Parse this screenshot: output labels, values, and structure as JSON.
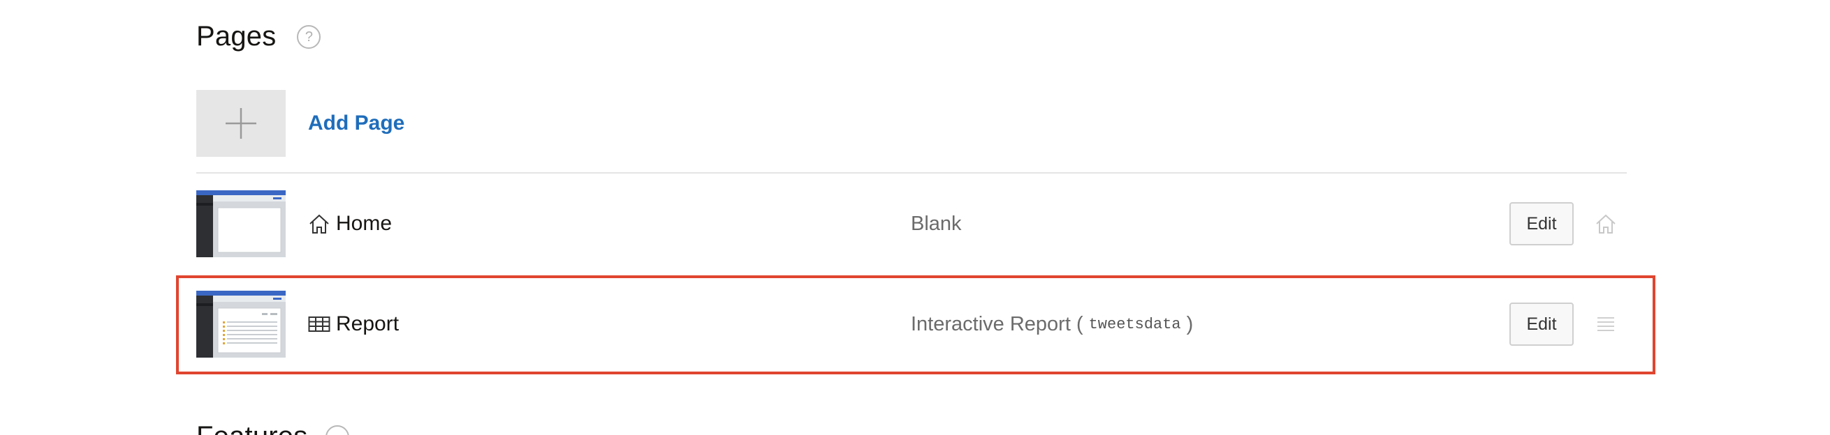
{
  "pages_section": {
    "title": "Pages",
    "help_icon": "?"
  },
  "add_page": {
    "label": "Add Page",
    "icon": "plus-icon"
  },
  "pages": [
    {
      "name": "Home",
      "icon": "home-icon",
      "type": "Blank",
      "edit_label": "Edit",
      "trailing_icon": "home-icon"
    },
    {
      "name": "Report",
      "icon": "table-icon",
      "type": "Interactive Report (",
      "type_source": "tweetsdata",
      "type_suffix": ")",
      "edit_label": "Edit",
      "trailing_icon": "drag-handle-icon"
    }
  ],
  "features_section": {
    "title": "Features"
  },
  "colors": {
    "link": "#1f6dbb",
    "highlight": "#e0452f",
    "thumb_header": "#3a67c4",
    "thumb_sidebar": "#2d2f33"
  }
}
